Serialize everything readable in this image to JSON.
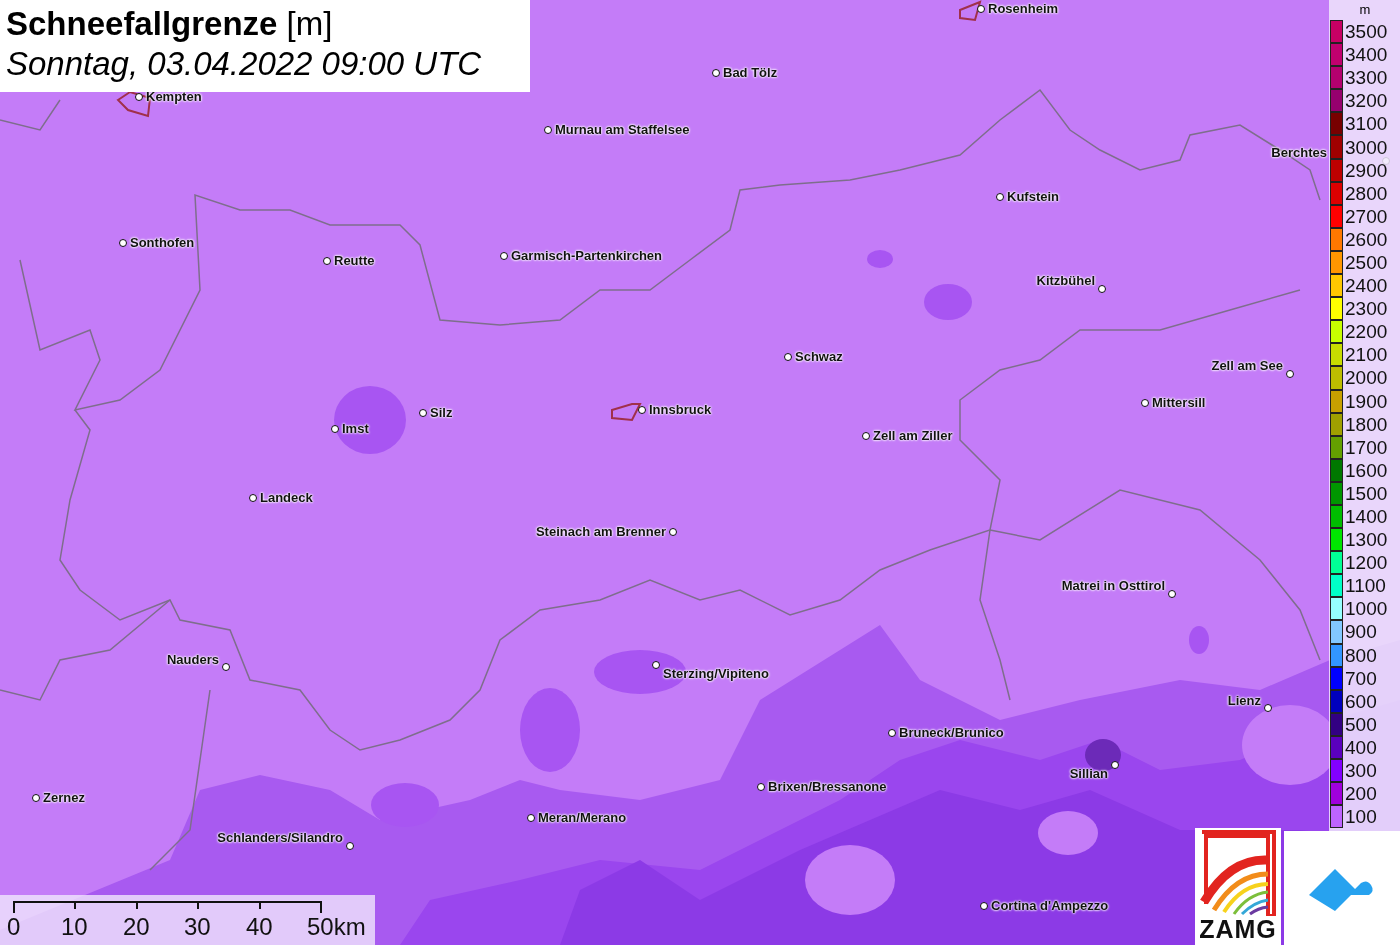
{
  "title": {
    "heading": "**Schneefallgrenze** [m]",
    "datetime": "Sonntag, 03.04.2022 09:00 UTC"
  },
  "cities": [
    {
      "name": "Rosenheim"
    },
    {
      "name": "Bad Tölz"
    },
    {
      "name": "Kempten"
    },
    {
      "name": "Murnau am Staffelsee"
    },
    {
      "name": "Berchtes"
    },
    {
      "name": "Kufstein"
    },
    {
      "name": "Sonthofen"
    },
    {
      "name": "Reutte"
    },
    {
      "name": "Garmisch-Partenkirchen"
    },
    {
      "name": "Kitzbühel"
    },
    {
      "name": "Schwaz"
    },
    {
      "name": "Zell am See"
    },
    {
      "name": "Mittersill"
    },
    {
      "name": "Innsbruck"
    },
    {
      "name": "Silz"
    },
    {
      "name": "Imst"
    },
    {
      "name": "Zell am Ziller"
    },
    {
      "name": "Landeck"
    },
    {
      "name": "Steinach am Brenner"
    },
    {
      "name": "Matrei in Osttirol"
    },
    {
      "name": "Nauders"
    },
    {
      "name": "Sterzing/Vipiteno"
    },
    {
      "name": "Lienz"
    },
    {
      "name": "Bruneck/Brunico"
    },
    {
      "name": "Sillian"
    },
    {
      "name": "Brixen/Bressanone"
    },
    {
      "name": "Zernez"
    },
    {
      "name": "Meran/Merano"
    },
    {
      "name": "Schlanders/Silandro"
    },
    {
      "name": "Cortina d'Ampezzo"
    }
  ],
  "legend": {
    "unit": "m",
    "items": [
      {
        "label": "3500",
        "color": "#c80064"
      },
      {
        "label": "3400",
        "color": "#c0006e"
      },
      {
        "label": "3300",
        "color": "#b4006e"
      },
      {
        "label": "3200",
        "color": "#96006e"
      },
      {
        "label": "3100",
        "color": "#780000"
      },
      {
        "label": "3000",
        "color": "#a00000"
      },
      {
        "label": "2900",
        "color": "#be0000"
      },
      {
        "label": "2800",
        "color": "#dc0000"
      },
      {
        "label": "2700",
        "color": "#ff0000"
      },
      {
        "label": "2600",
        "color": "#ff7800"
      },
      {
        "label": "2500",
        "color": "#ff9600"
      },
      {
        "label": "2400",
        "color": "#ffc800"
      },
      {
        "label": "2300",
        "color": "#ffff00"
      },
      {
        "label": "2200",
        "color": "#c8ff00"
      },
      {
        "label": "2100",
        "color": "#c8dc00"
      },
      {
        "label": "2000",
        "color": "#bebe00"
      },
      {
        "label": "1900",
        "color": "#c8a000"
      },
      {
        "label": "1800",
        "color": "#a0a000"
      },
      {
        "label": "1700",
        "color": "#64a000"
      },
      {
        "label": "1600",
        "color": "#007800"
      },
      {
        "label": "1500",
        "color": "#009600"
      },
      {
        "label": "1400",
        "color": "#00be00"
      },
      {
        "label": "1300",
        "color": "#00e600"
      },
      {
        "label": "1200",
        "color": "#00ff96"
      },
      {
        "label": "1100",
        "color": "#00ffc8"
      },
      {
        "label": "1000",
        "color": "#96ffff"
      },
      {
        "label": "900",
        "color": "#82c8ff"
      },
      {
        "label": "800",
        "color": "#3296ff"
      },
      {
        "label": "700",
        "color": "#0000ff"
      },
      {
        "label": "600",
        "color": "#0000be"
      },
      {
        "label": "500",
        "color": "#320082"
      },
      {
        "label": "400",
        "color": "#5a00be"
      },
      {
        "label": "300",
        "color": "#8200ff"
      },
      {
        "label": "200",
        "color": "#a000dc"
      },
      {
        "label": "100",
        "color": "#be64ff"
      }
    ]
  },
  "scale_bar": {
    "labels": [
      "0",
      "10",
      "20",
      "30",
      "40",
      "50km"
    ]
  },
  "logos": {
    "zamg": "ZAMG"
  }
}
